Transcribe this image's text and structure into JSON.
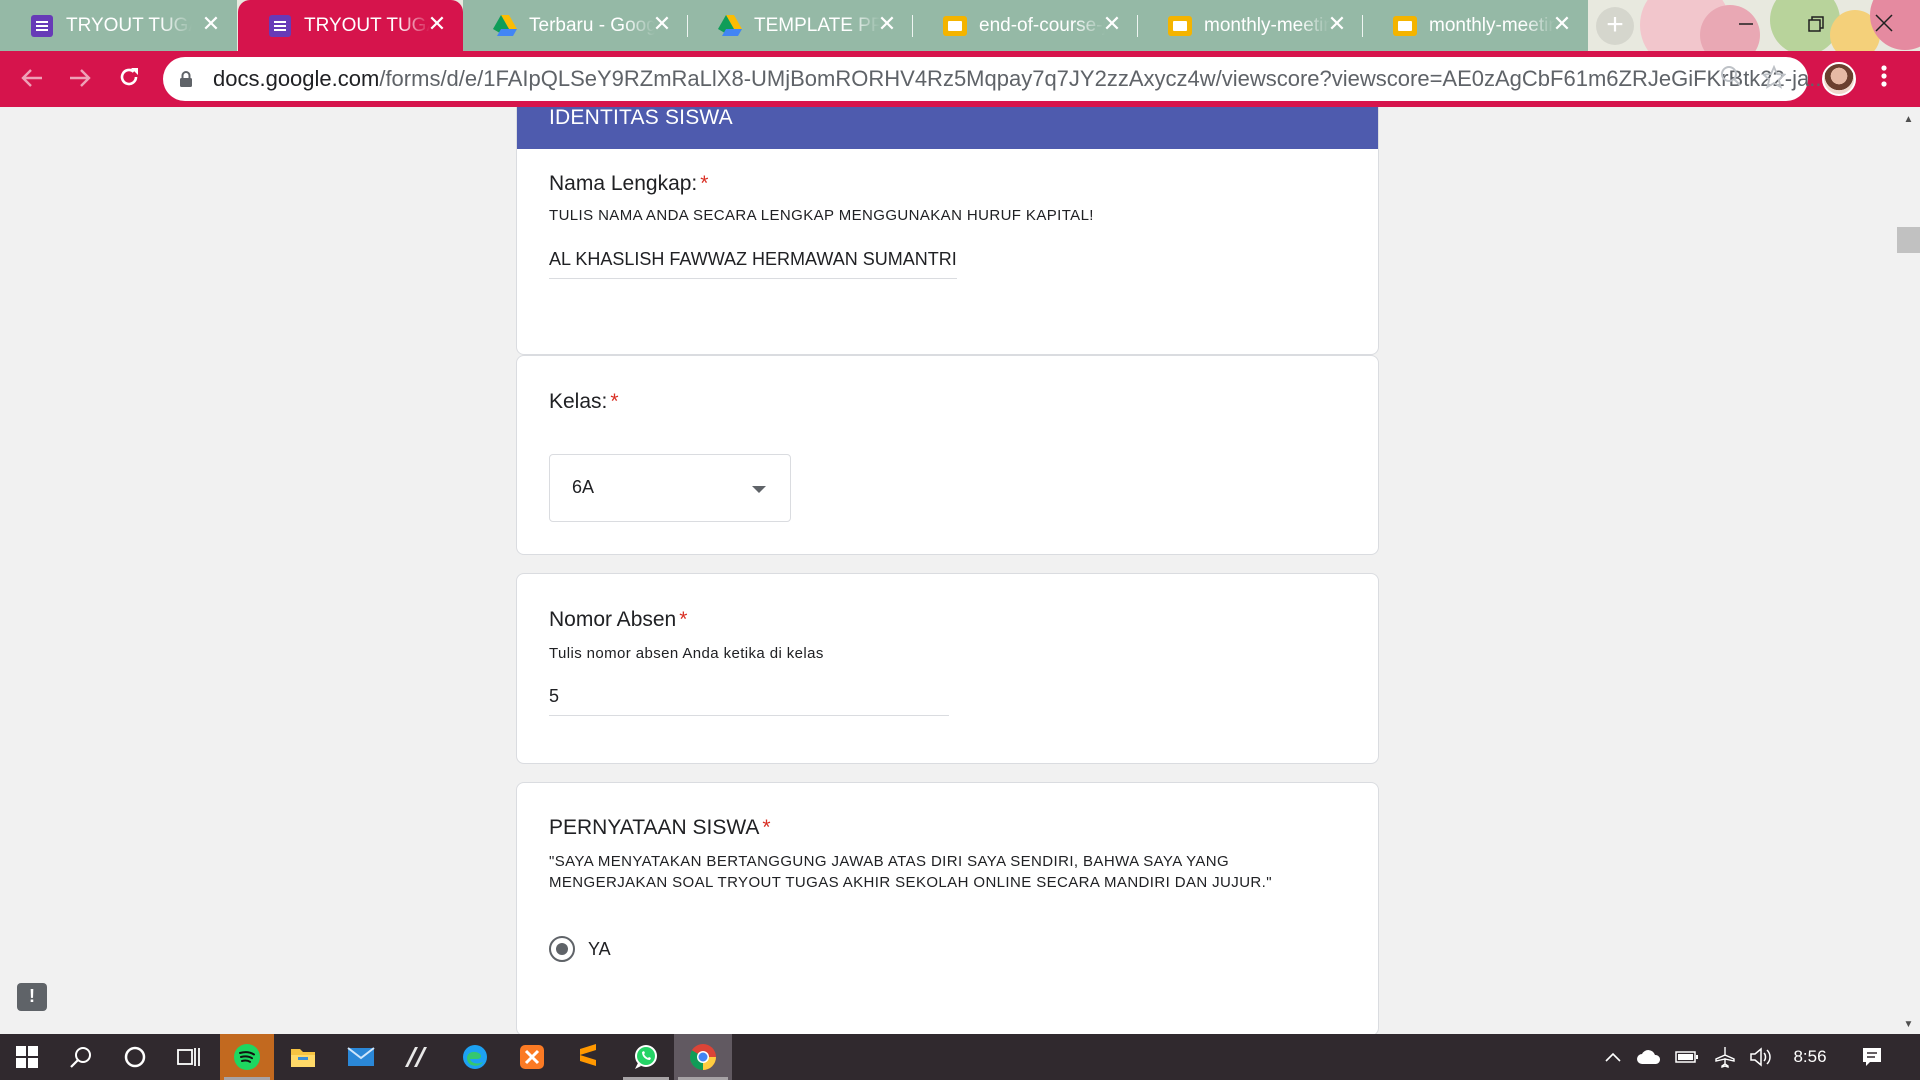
{
  "browser": {
    "tabs": [
      {
        "title": "TRYOUT TUGAS AKHIR SEKOLAH",
        "icon": "google-forms-icon",
        "active": false
      },
      {
        "title": "TRYOUT TUGAS AKHIR SEKOLAH",
        "icon": "google-forms-icon",
        "active": true
      },
      {
        "title": "Terbaru - Google Drive",
        "icon": "google-drive-icon",
        "active": false
      },
      {
        "title": "TEMPLATE PPT - Google Drive",
        "icon": "google-drive-icon",
        "active": false
      },
      {
        "title": "end-of-course-journal",
        "icon": "google-slides-icon",
        "active": false
      },
      {
        "title": "monthly-meeting",
        "icon": "google-slides-icon",
        "active": false
      },
      {
        "title": "monthly-meeting",
        "icon": "google-slides-icon",
        "active": false
      }
    ],
    "close_glyph": "✕",
    "new_tab_glyph": "+",
    "url_host": "docs.google.com",
    "url_path": "/forms/d/e/1FAIpQLSeY9RZmRaLlX8-UMjBomRORHV4Rz5Mqpay7q7JY2zzAxycz4w/viewscore?viewscore=AE0zAgCbF61m6ZRJeGiFKrBtk22-ja...",
    "accent_color": "#d6144c"
  },
  "form": {
    "section_title": "IDENTITAS SISWA",
    "header_color": "#4e5bae",
    "questions": {
      "nama": {
        "title": "Nama Lengkap:",
        "required": "*",
        "description": "TULIS NAMA ANDA SECARA LENGKAP MENGGUNAKAN HURUF KAPITAL!",
        "answer": "AL KHASLISH FAWWAZ HERMAWAN SUMANTRI"
      },
      "kelas": {
        "title": "Kelas:",
        "required": "*",
        "selected": "6A"
      },
      "absen": {
        "title": "Nomor Absen",
        "required": "*",
        "description": "Tulis nomor absen Anda ketika di kelas",
        "answer": "5"
      },
      "pernyataan": {
        "title": "PERNYATAAN SISWA",
        "required": "*",
        "description_line1": "\"SAYA MENYATAKAN BERTANGGUNG JAWAB ATAS DIRI SAYA SENDIRI, BAHWA SAYA YANG",
        "description_line2": "MENGERJAKAN SOAL TRYOUT TUGAS AKHIR SEKOLAH ONLINE SECARA MANDIRI DAN JUJUR.\"",
        "option": "YA"
      }
    },
    "feedback_glyph": "!"
  },
  "taskbar": {
    "apps": [
      "windows-start-icon",
      "search-icon",
      "cortana-icon",
      "task-view-icon",
      "spotify-icon",
      "file-explorer-icon",
      "mail-icon",
      "pen-app-icon",
      "edge-icon",
      "xampp-icon",
      "sublime-text-icon",
      "whatsapp-icon",
      "chrome-icon"
    ],
    "clock": "8:56"
  }
}
